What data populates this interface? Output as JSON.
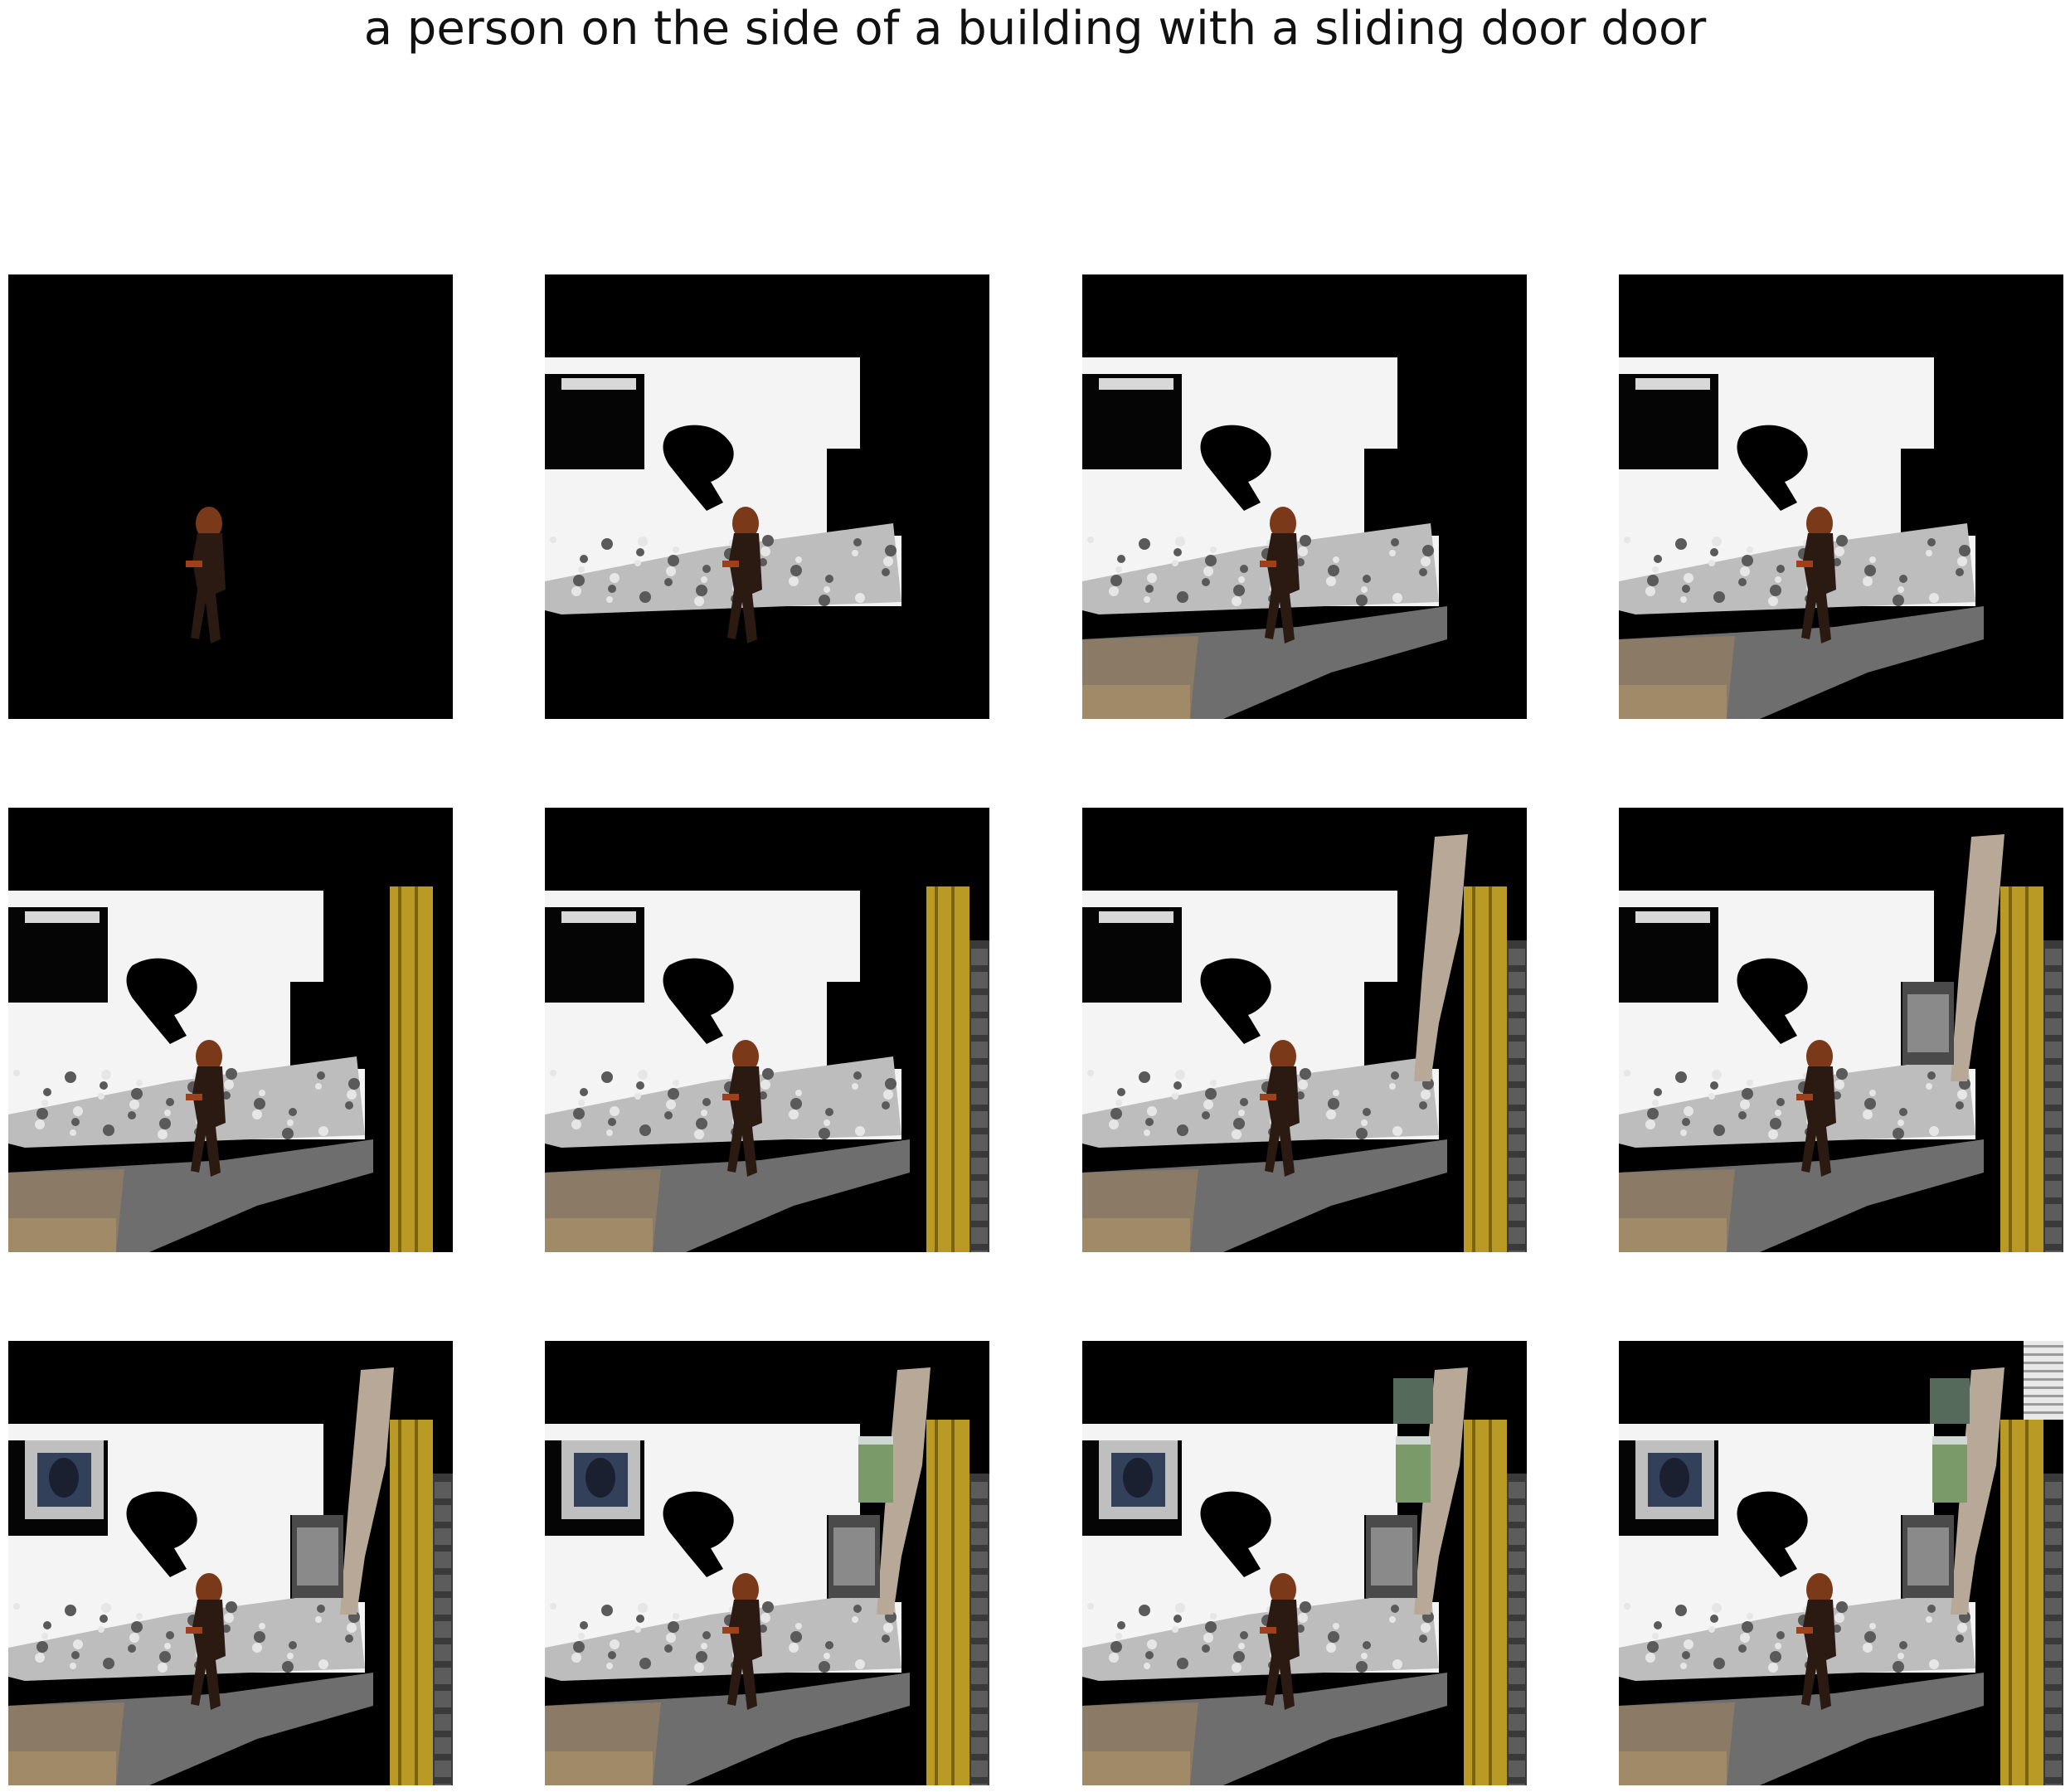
{
  "title": "a person on the side of a building with a sliding door door",
  "colors": {
    "background": "#ffffff",
    "title_text": "#111111",
    "mask": "#000000",
    "wall": "#f4f4f4",
    "door_yellow": "#b89a24",
    "floor": "#8a7a66",
    "person": "#2a1a12",
    "hair": "#7a3a1a"
  },
  "grid": {
    "rows": 3,
    "columns": 4
  },
  "panels": [
    {
      "step": 1,
      "layers": [
        "person"
      ]
    },
    {
      "step": 2,
      "layers": [
        "person",
        "wall",
        "splash"
      ]
    },
    {
      "step": 3,
      "layers": [
        "person",
        "wall",
        "splash",
        "floor"
      ]
    },
    {
      "step": 4,
      "layers": [
        "person",
        "wall",
        "splash",
        "floor",
        "right-gap"
      ]
    },
    {
      "step": 5,
      "layers": [
        "person",
        "wall",
        "splash",
        "floor",
        "door"
      ]
    },
    {
      "step": 6,
      "layers": [
        "person",
        "wall",
        "splash",
        "floor",
        "door",
        "brick"
      ]
    },
    {
      "step": 7,
      "layers": [
        "person",
        "wall",
        "splash",
        "floor",
        "door",
        "brick",
        "pillar"
      ]
    },
    {
      "step": 8,
      "layers": [
        "person",
        "wall",
        "splash",
        "floor",
        "door",
        "brick",
        "pillar",
        "bin"
      ]
    },
    {
      "step": 9,
      "layers": [
        "person",
        "wall",
        "splash",
        "floor",
        "door",
        "brick",
        "pillar",
        "bin",
        "picture"
      ]
    },
    {
      "step": 10,
      "layers": [
        "person",
        "wall",
        "splash",
        "floor",
        "door",
        "brick",
        "pillar",
        "bin",
        "picture",
        "window"
      ]
    },
    {
      "step": 11,
      "layers": [
        "person",
        "wall",
        "splash",
        "floor",
        "door",
        "brick",
        "pillar",
        "bin",
        "picture",
        "window",
        "awning"
      ]
    },
    {
      "step": 12,
      "layers": [
        "person",
        "wall",
        "splash",
        "floor",
        "door",
        "brick",
        "pillar",
        "bin",
        "picture",
        "window",
        "awning",
        "blinds"
      ]
    }
  ]
}
